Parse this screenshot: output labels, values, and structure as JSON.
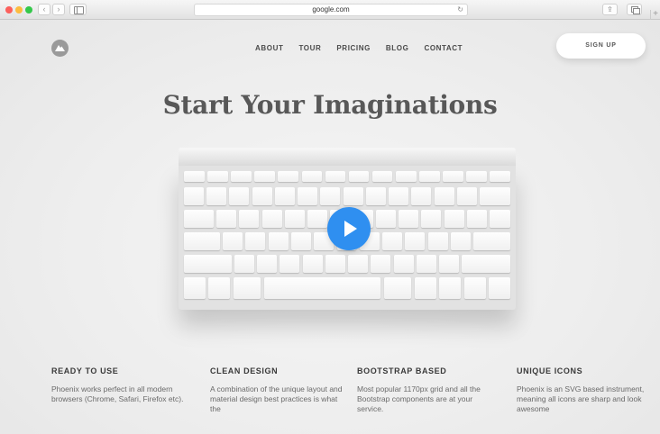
{
  "browser": {
    "url": "google.com",
    "reload_glyph": "↻",
    "back_glyph": "‹",
    "forward_glyph": "›",
    "share_glyph": "⇪",
    "newtab_glyph": "+"
  },
  "nav": {
    "items": [
      "ABOUT",
      "TOUR",
      "PRICING",
      "BLOG",
      "CONTACT"
    ],
    "signup_label": "SIGN UP"
  },
  "hero": {
    "title": "Start Your Imaginations",
    "play_color": "#2f8ff0"
  },
  "features": [
    {
      "title": "READY TO USE",
      "text": "Phoenix works perfect in all modern browsers (Chrome, Safari, Firefox etc)."
    },
    {
      "title": "CLEAN DESIGN",
      "text": "A combination of the unique layout and material design best practices is what the"
    },
    {
      "title": "BOOTSTRAP BASED",
      "text": "Most popular 1170px grid and all the Bootstrap components are at your service."
    },
    {
      "title": "UNIQUE ICONS",
      "text": "Phoenix is an SVG based instrument, meaning all icons are sharp and look awesome"
    }
  ]
}
